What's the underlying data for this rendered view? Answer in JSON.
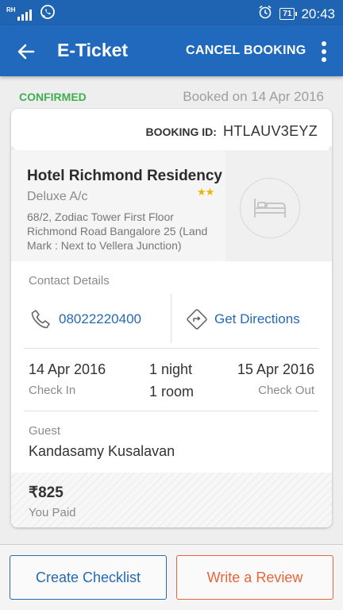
{
  "status_bar": {
    "carrier_indicator": "RH",
    "battery_level": "71",
    "time": "20:43",
    "icons": [
      "signal-icon",
      "whatsapp-icon",
      "alarm-icon",
      "battery-icon"
    ]
  },
  "app_bar": {
    "title": "E-Ticket",
    "cancel_label": "CANCEL BOOKING",
    "icons": [
      "back-arrow-icon",
      "overflow-menu-icon"
    ]
  },
  "booking": {
    "status": "CONFIRMED",
    "booked_on_prefix": "Booked on",
    "booked_on_date": "14 Apr 2016",
    "id_label": "BOOKING ID:",
    "id_value": "HTLAUV3EYZ"
  },
  "hotel": {
    "name": "Hotel Richmond Residency",
    "room_type": "Deluxe A/c",
    "address": "68/2, Zodiac Tower First Floor Richmond Road Bangalore 25 (Land Mark : Next to Vellera Junction)",
    "stars": "★★",
    "star_rating": 2,
    "image_icon": "bed-icon"
  },
  "contact": {
    "label": "Contact Details",
    "phone": "08022220400",
    "directions_label": "Get Directions"
  },
  "stay": {
    "check_in_date": "14 Apr 2016",
    "check_in_label": "Check In",
    "nights": "1 night",
    "rooms": "1 room",
    "check_out_date": "15 Apr 2016",
    "check_out_label": "Check Out"
  },
  "guest": {
    "label": "Guest",
    "name": "Kandasamy Kusalavan"
  },
  "payment": {
    "amount": "₹825",
    "label": "You Paid"
  },
  "actions": {
    "checklist_label": "Create Checklist",
    "review_label": "Write a Review"
  },
  "colors": {
    "app_bar": "#2169bd",
    "status_bar": "#1f64b3",
    "confirmed": "#3fae4f",
    "link": "#2669b3",
    "review_accent": "#e8643a",
    "stars": "#e8b800"
  }
}
